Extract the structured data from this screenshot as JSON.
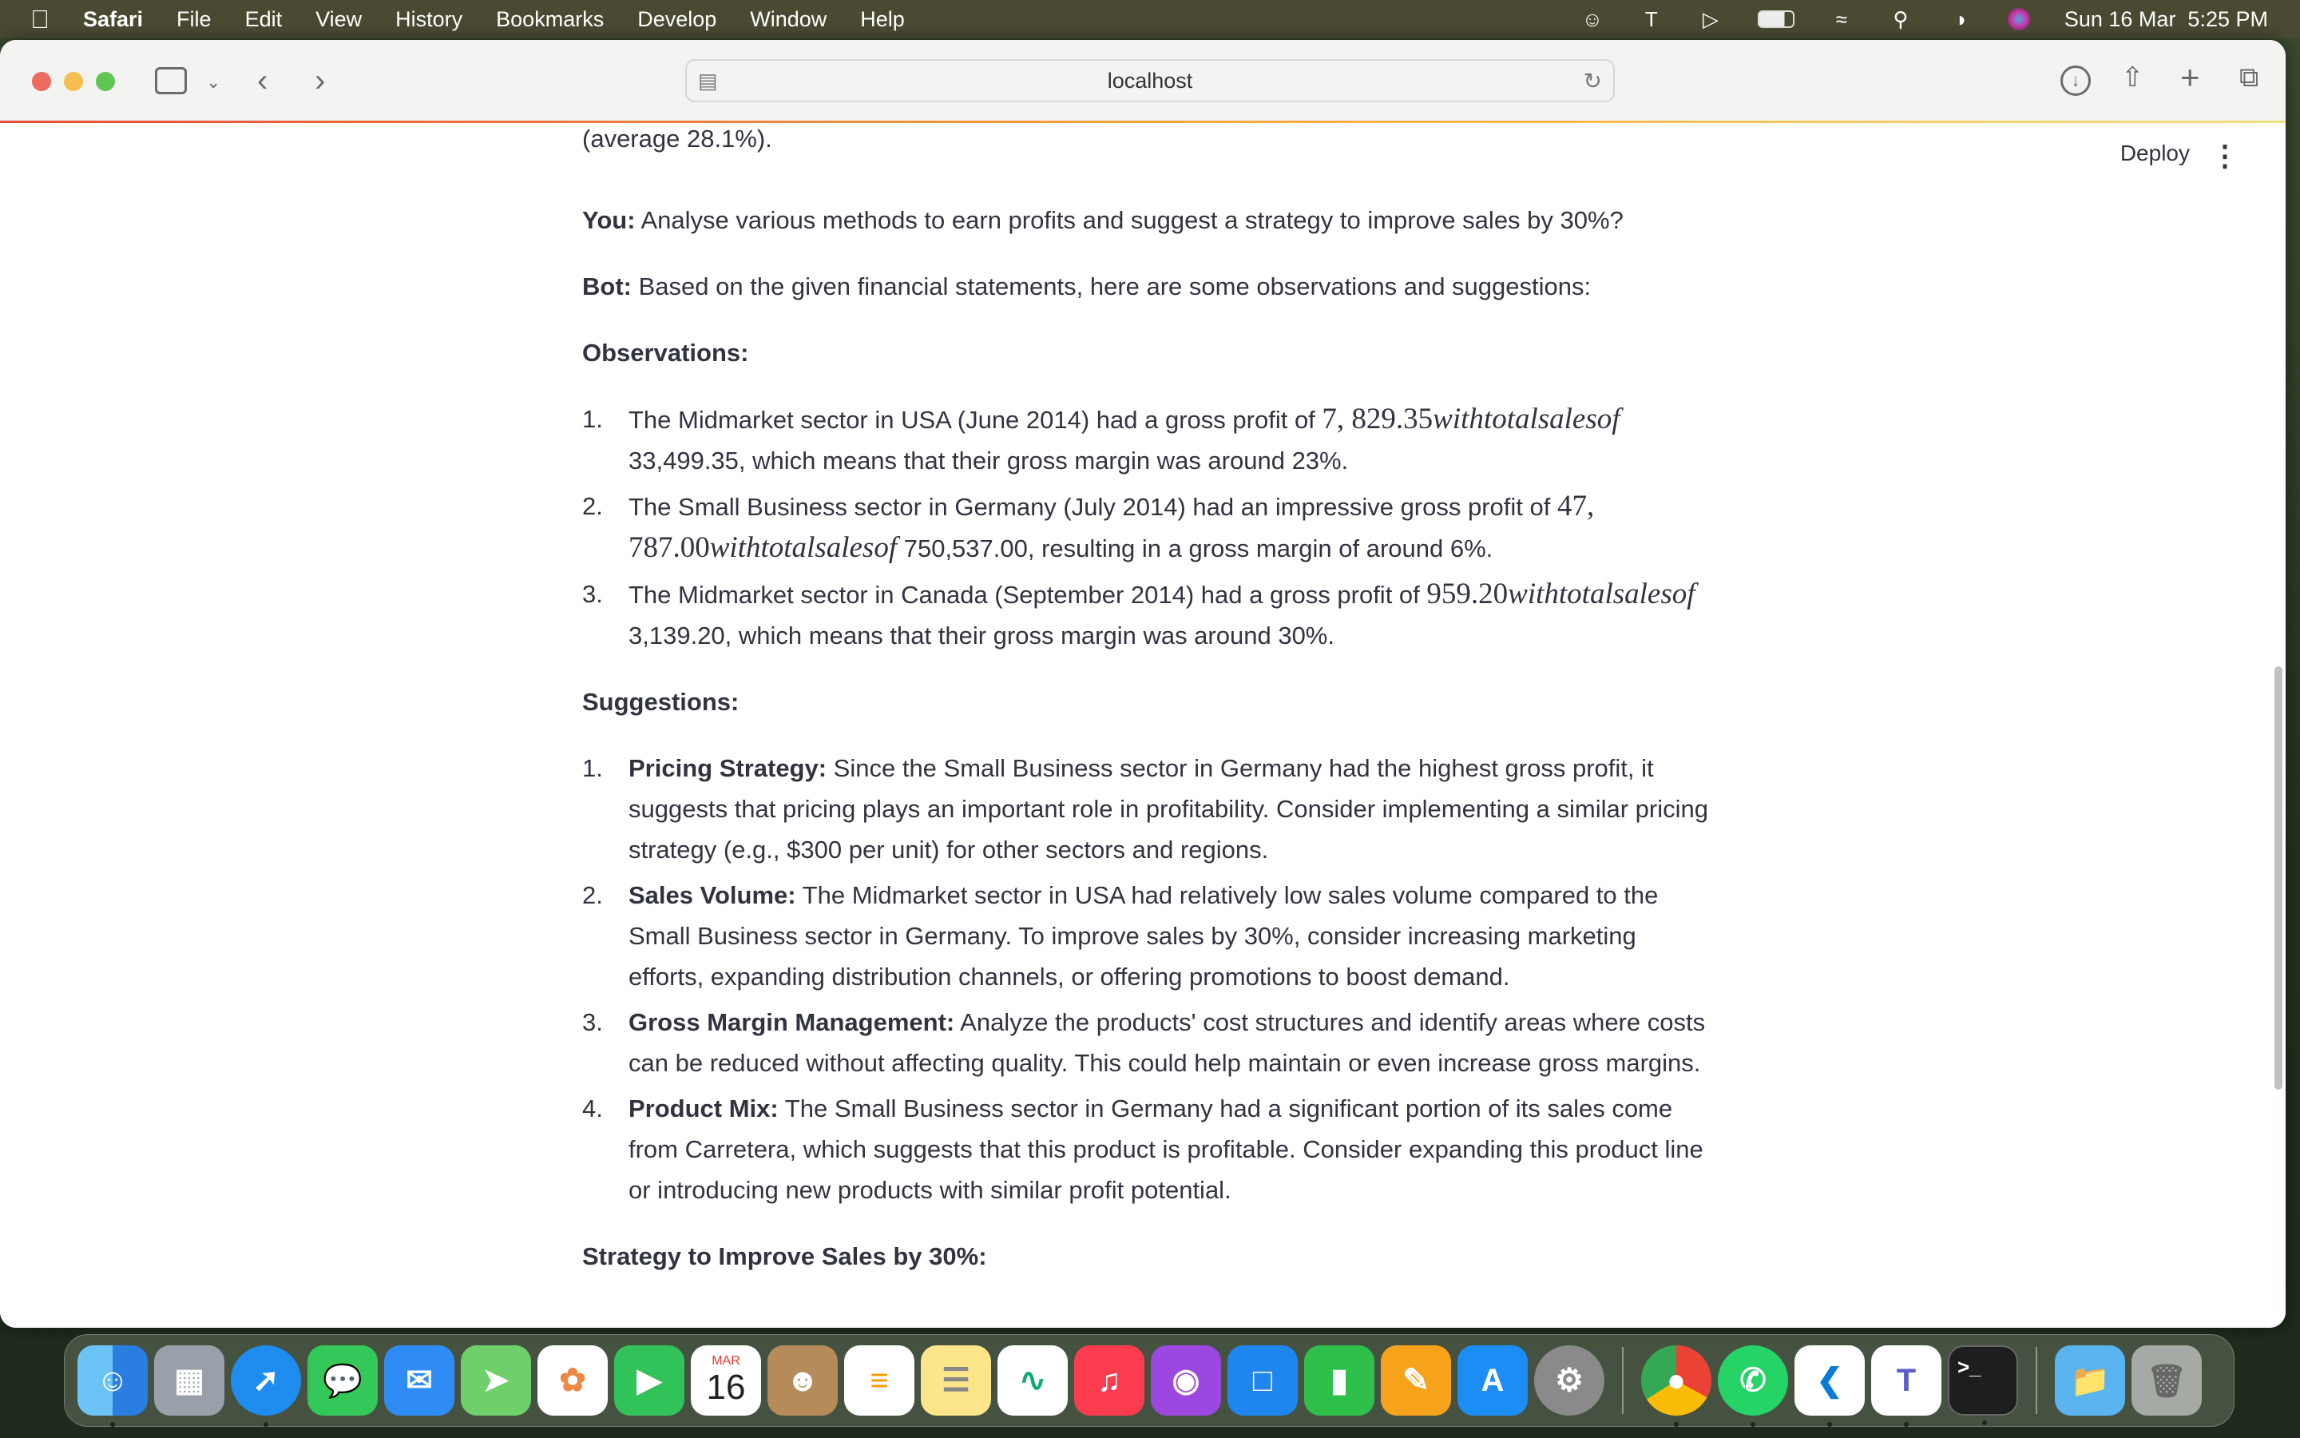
{
  "menubar": {
    "app": "Safari",
    "items": [
      "File",
      "Edit",
      "View",
      "History",
      "Bookmarks",
      "Develop",
      "Window",
      "Help"
    ],
    "datetime": "Sun 16 Mar  5:25 PM"
  },
  "browser": {
    "url": "localhost"
  },
  "app": {
    "deploy": "Deploy"
  },
  "chat": {
    "prev_tail": "(average 28.1%).",
    "you_label": "You:",
    "you_text": " Analyse various methods to earn profits and suggest a strategy to improve sales by 30%?",
    "bot_label": "Bot:",
    "bot_text": " Based on the given financial statements, here are some observations and suggestions:",
    "obs_heading": "Observations:",
    "observations": [
      {
        "num": "1.",
        "pre": "The Midmarket sector in USA (June 2014) had a gross profit of ",
        "math_num": "7, 829.35",
        "math_it": "withtotalsalesof",
        "post": " 33,499.35, which means that their gross margin was around 23%."
      },
      {
        "num": "2.",
        "pre": "The Small Business sector in Germany (July 2014) had an impressive gross profit of ",
        "math_num": "47, 787.00",
        "math_it": "withtotalsalesof",
        "post": " 750,537.00, resulting in a gross margin of around 6%."
      },
      {
        "num": "3.",
        "pre": "The Midmarket sector in Canada (September 2014) had a gross profit of ",
        "math_num": "959.20",
        "math_it": "withtotalsalesof",
        "post": " 3,139.20, which means that their gross margin was around 30%."
      }
    ],
    "sug_heading": "Suggestions:",
    "suggestions": [
      {
        "num": "1.",
        "title": "Pricing Strategy:",
        "text": " Since the Small Business sector in Germany had the highest gross profit, it suggests that pricing plays an important role in profitability. Consider implementing a similar pricing strategy (e.g., $300 per unit) for other sectors and regions."
      },
      {
        "num": "2.",
        "title": "Sales Volume:",
        "text": " The Midmarket sector in USA had relatively low sales volume compared to the Small Business sector in Germany. To improve sales by 30%, consider increasing marketing efforts, expanding distribution channels, or offering promotions to boost demand."
      },
      {
        "num": "3.",
        "title": "Gross Margin Management:",
        "text": " Analyze the products' cost structures and identify areas where costs can be reduced without affecting quality. This could help maintain or even increase gross margins."
      },
      {
        "num": "4.",
        "title": "Product Mix:",
        "text": " The Small Business sector in Germany had a significant portion of its sales come from Carretera, which suggests that this product is profitable. Consider expanding this product line or introducing new products with similar profit potential."
      }
    ],
    "strategy_heading": "Strategy to Improve Sales by 30%:"
  },
  "dock": {
    "calendar_month": "MAR",
    "calendar_day": "16"
  }
}
